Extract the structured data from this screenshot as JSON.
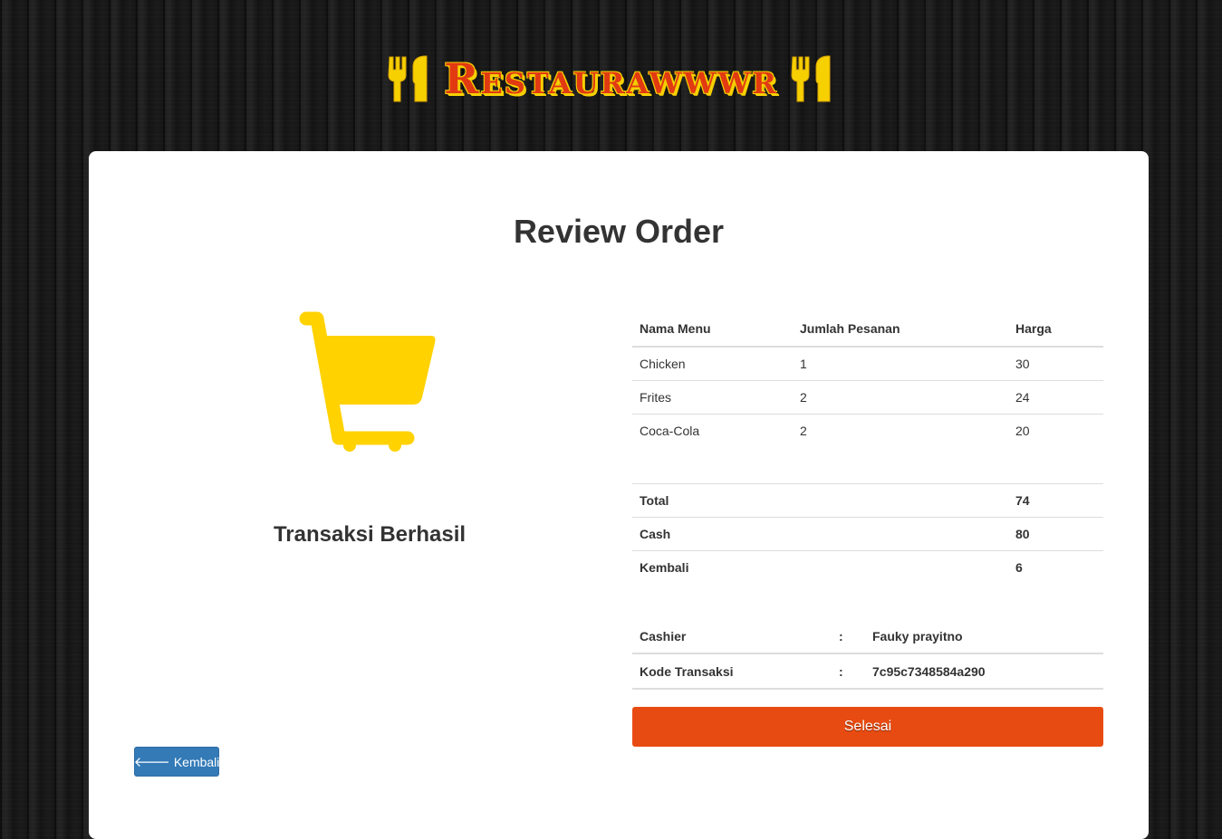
{
  "colors": {
    "brand_red": "#e13a12",
    "brand_yellow": "#f6d000",
    "cart_yellow": "#ffd200",
    "primary_blue": "#337ab7",
    "finish_orange": "#e84b11"
  },
  "brand": {
    "title": "Restaurawwwr",
    "icon": "fork-knife-icon"
  },
  "page": {
    "title": "Review Order"
  },
  "status": {
    "icon": "shopping-cart-icon",
    "text": "Transaksi Berhasil"
  },
  "orders": {
    "headers": [
      "Nama Menu",
      "Jumlah Pesanan",
      "Harga"
    ],
    "rows": [
      [
        "Chicken",
        "1",
        "30"
      ],
      [
        "Frites",
        "2",
        "24"
      ],
      [
        "Coca-Cola",
        "2",
        "20"
      ]
    ]
  },
  "totals": [
    {
      "label": "Total",
      "value": "74"
    },
    {
      "label": "Cash",
      "value": "80"
    },
    {
      "label": "Kembali",
      "value": "6"
    }
  ],
  "info": [
    {
      "label": "Cashier",
      "sep": ":",
      "value": "Fauky prayitno"
    },
    {
      "label": "Kode Transaksi",
      "sep": ":",
      "value": "7c95c7348584a290"
    }
  ],
  "buttons": {
    "finish": "Selesai",
    "back": "Kembali",
    "back_icon": "arrow-left-icon"
  }
}
